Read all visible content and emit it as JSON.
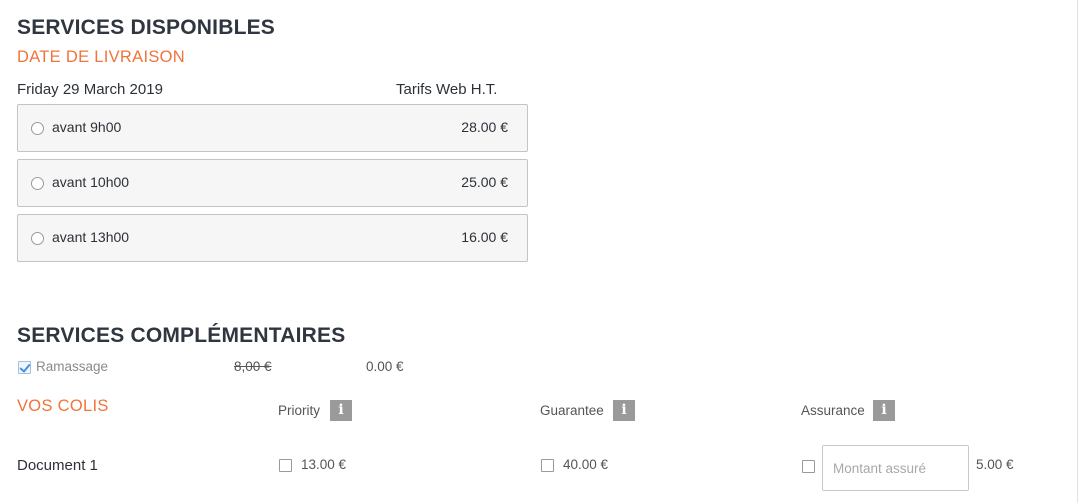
{
  "services": {
    "title": "SERVICES DISPONIBLES",
    "section_label": "DATE DE LIVRAISON",
    "date": "Friday 29 March 2019",
    "rates_label": "Tarifs Web H.T.",
    "options": [
      {
        "label": "avant 9h00",
        "price": "28.00 €"
      },
      {
        "label": "avant 10h00",
        "price": "25.00 €"
      },
      {
        "label": "avant 13h00",
        "price": "16.00 €"
      }
    ]
  },
  "complementary": {
    "title": "SERVICES COMPLÉMENTAIRES",
    "pickup": {
      "label": "Ramassage",
      "old_price": "8,00 €",
      "price": "0.00 €",
      "checked": true
    }
  },
  "parcels": {
    "title": "VOS COLIS",
    "columns": [
      {
        "label": "Priority",
        "info": "i"
      },
      {
        "label": "Guarantee",
        "info": "i"
      },
      {
        "label": "Assurance",
        "info": "i"
      }
    ],
    "rows": [
      {
        "name": "Document 1",
        "priority_price": "13.00 €",
        "guarantee_price": "40.00 €",
        "insurance_placeholder": "Montant assuré",
        "insurance_price": "5.00 €"
      }
    ]
  },
  "colors": {
    "accent": "#f0743b",
    "heading": "#2f3640",
    "checkbox_check": "#4a90d9"
  }
}
